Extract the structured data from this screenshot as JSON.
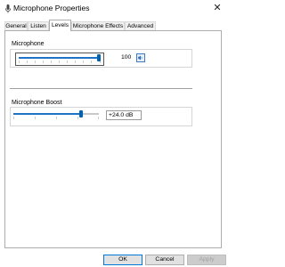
{
  "window": {
    "title": "Microphone Properties",
    "close_label": "✕"
  },
  "tabs": [
    {
      "label": "General",
      "active": false
    },
    {
      "label": "Listen",
      "active": false
    },
    {
      "label": "Levels",
      "active": true
    },
    {
      "label": "Microphone Effects",
      "active": false
    },
    {
      "label": "Advanced",
      "active": false
    }
  ],
  "microphone": {
    "label": "Microphone",
    "value": "100",
    "level_fraction": 1.0,
    "mute_icon": "speaker-icon"
  },
  "boost": {
    "label": "Microphone Boost",
    "value": "+24.0 dB",
    "level_fraction": 0.8
  },
  "buttons": {
    "ok": "OK",
    "cancel": "Cancel",
    "apply": "Apply"
  },
  "colors": {
    "accent": "#0063b1",
    "focus_border": "#0078d7"
  }
}
